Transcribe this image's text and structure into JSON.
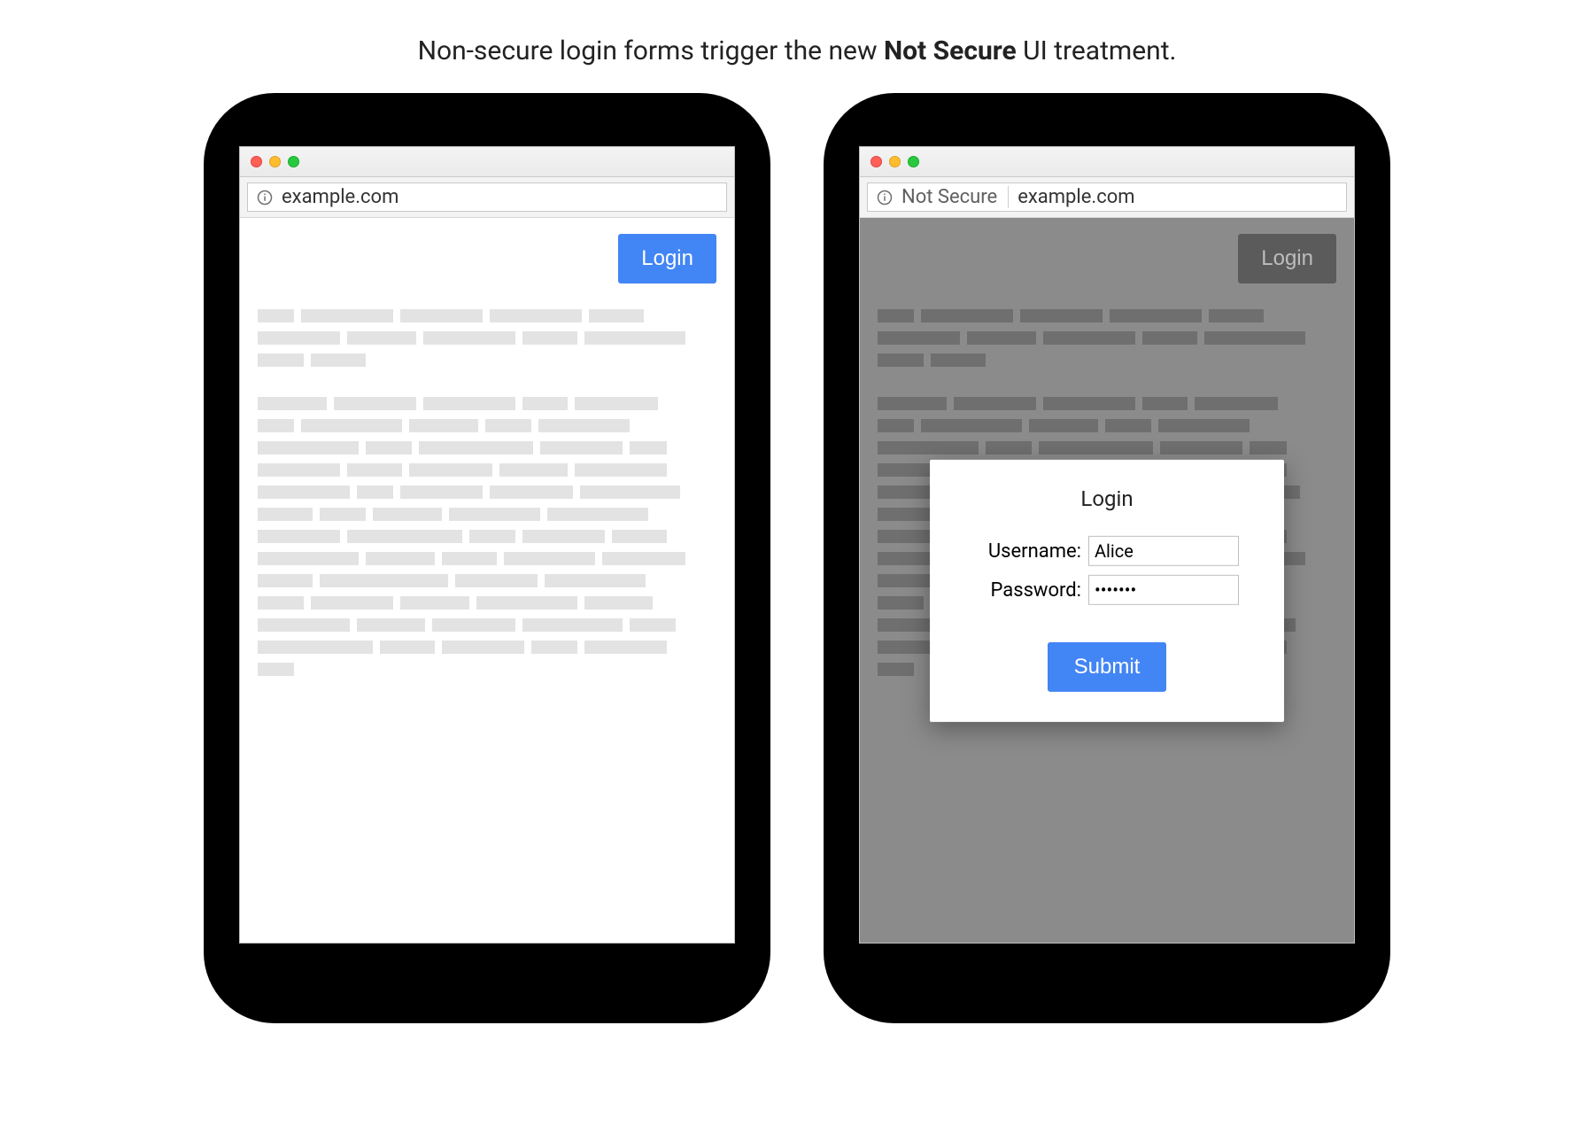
{
  "caption": {
    "pre": "Non-secure login forms trigger the new ",
    "bold": "Not Secure",
    "post": " UI treatment."
  },
  "left": {
    "url": "example.com",
    "login_button": "Login"
  },
  "right": {
    "not_secure_label": "Not Secure",
    "url": "example.com",
    "login_button": "Login",
    "modal": {
      "title": "Login",
      "username_label": "Username:",
      "username_value": "Alice",
      "password_label": "Password:",
      "password_value": "•••••••",
      "submit_label": "Submit"
    }
  },
  "colors": {
    "accent_blue": "#4285f4",
    "traffic_red": "#ff5f56",
    "traffic_yellow": "#ffbd2e",
    "traffic_green": "#27c93f",
    "dim_overlay": "#8b8b8b"
  }
}
